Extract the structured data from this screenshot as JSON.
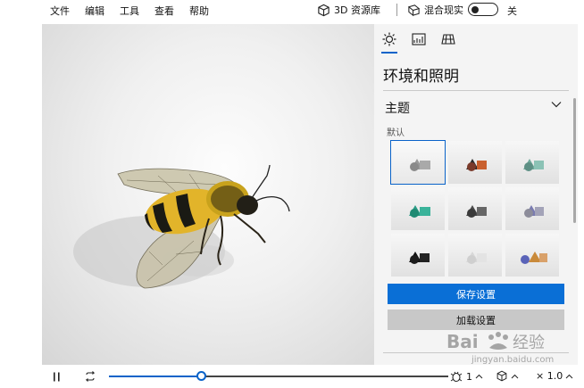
{
  "menu": {
    "items": [
      "文件",
      "编辑",
      "工具",
      "查看",
      "帮助"
    ],
    "library_label": "3D 资源库",
    "mixed_reality_label": "混合现实",
    "toggle_state": "关"
  },
  "panel": {
    "tabs": [
      "sun-icon",
      "stats-icon",
      "grid-icon"
    ],
    "active_tab": 0,
    "title": "环境和照明",
    "section_title": "主题",
    "section_sub": "默认",
    "themes": [
      {
        "shapes": "gray",
        "selected": true
      },
      {
        "shapes": "dark-red"
      },
      {
        "shapes": "teal"
      },
      {
        "shapes": "green"
      },
      {
        "shapes": "dark-gray"
      },
      {
        "shapes": "purple"
      },
      {
        "shapes": "black"
      },
      {
        "shapes": "white"
      },
      {
        "shapes": "blue-orange"
      }
    ],
    "save_label": "保存设置",
    "load_label": "加载设置"
  },
  "playback": {
    "progress": 0.27,
    "animation_count": "1",
    "speed": "× 1.0"
  },
  "colors": {
    "accent": "#0a63c9",
    "save_button": "#0a6fd6",
    "load_button": "#c8c8c8"
  },
  "watermark": {
    "text": "Bai 经验",
    "url": "jingyan.baidu.com"
  }
}
